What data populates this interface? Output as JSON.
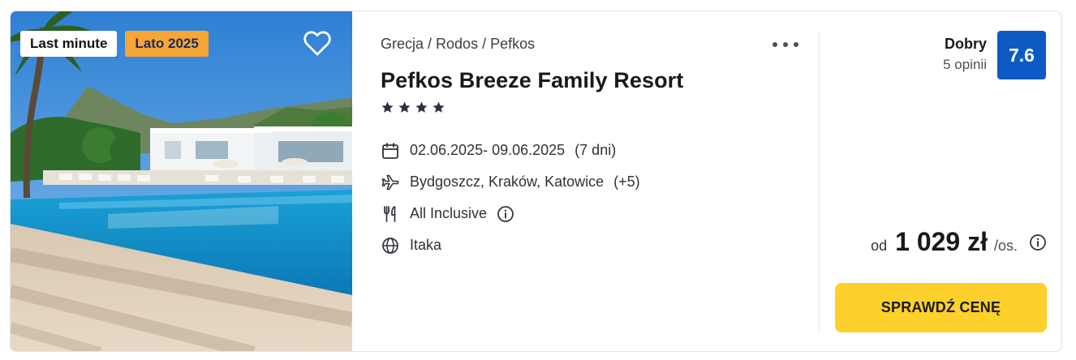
{
  "offer": {
    "badges": {
      "last_minute": "Last minute",
      "season": "Lato 2025"
    },
    "breadcrumb": {
      "country": "Grecja",
      "region": "Rodos",
      "city": "Pefkos",
      "separator": " / "
    },
    "hotel_name": "Pefkos Breeze Family Resort",
    "star_rating": 4,
    "dates": {
      "range": "02.06.2025- 09.06.2025",
      "duration": "(7 dni)"
    },
    "departure": {
      "airports": "Bydgoszcz, Kraków, Katowice",
      "more": "(+5)"
    },
    "board": "All Inclusive",
    "operator": "Itaka",
    "rating": {
      "label": "Dobry",
      "reviews": "5 opinii",
      "score": "7.6"
    },
    "price": {
      "prefix": "od",
      "amount": "1 029 zł",
      "suffix": "/os."
    },
    "cta_label": "SPRAWDŹ CENĘ"
  },
  "icons": {
    "favorite": "heart-outline-icon",
    "more": "more-horizontal-icon",
    "dates": "calendar-icon",
    "departure": "plane-icon",
    "board": "cutlery-icon",
    "operator": "globe-icon",
    "info": "info-circle-icon",
    "star": "star-icon"
  },
  "colors": {
    "badge_season_bg": "#f7a635",
    "badge_season_text": "#1a2b66",
    "score_bg": "#0c5bc4",
    "cta_bg": "#fdd02b"
  }
}
